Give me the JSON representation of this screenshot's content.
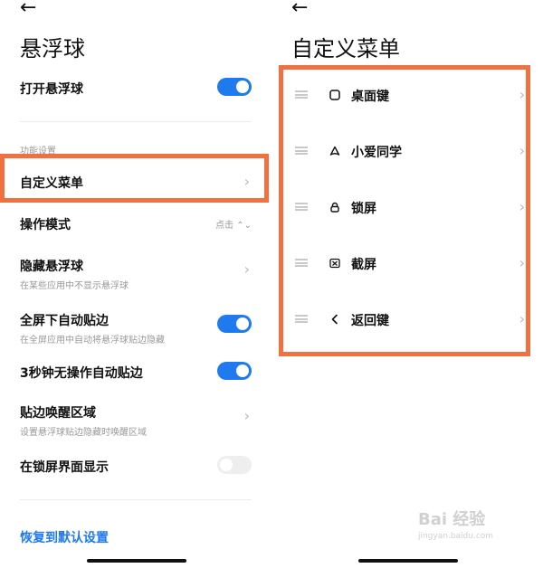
{
  "left": {
    "back_icon": "←",
    "title": "悬浮球",
    "open_floating": {
      "label": "打开悬浮球"
    },
    "section_label": "功能设置",
    "custom_menu": {
      "label": "自定义菜单"
    },
    "mode": {
      "label": "操作模式",
      "value": "点击 ⌃⌄"
    },
    "hide": {
      "label": "隐藏悬浮球",
      "sub": "在某些应用中不显示悬浮球"
    },
    "fullscreen": {
      "label": "全屏下自动贴边",
      "sub": "在全屏应用中自动将悬浮球贴边隐藏"
    },
    "idle_stick": {
      "label": "3秒钟无操作自动贴边"
    },
    "wake_area": {
      "label": "贴边唤醒区域",
      "sub": "设置悬浮球贴边隐藏时唤醒区域"
    },
    "lockscreen": {
      "label": "在锁屏界面显示"
    },
    "reset_label": "恢复到默认设置",
    "chevron": "›"
  },
  "right": {
    "back_icon": "←",
    "title": "自定义菜单",
    "items": [
      {
        "label": "桌面键",
        "icon": "home-square-icon"
      },
      {
        "label": "小爱同学",
        "icon": "xiaoai-icon"
      },
      {
        "label": "锁屏",
        "icon": "lock-icon"
      },
      {
        "label": "截屏",
        "icon": "screenshot-icon"
      },
      {
        "label": "返回键",
        "icon": "back-chevron-icon"
      }
    ],
    "chevron": "›"
  },
  "watermark": {
    "main": "Bai 经验",
    "sub": "jingyan.baidu.com"
  },
  "colors": {
    "accent": "#1f7af0",
    "highlight": "#f07040",
    "toggle_off": "#eeeeee"
  }
}
